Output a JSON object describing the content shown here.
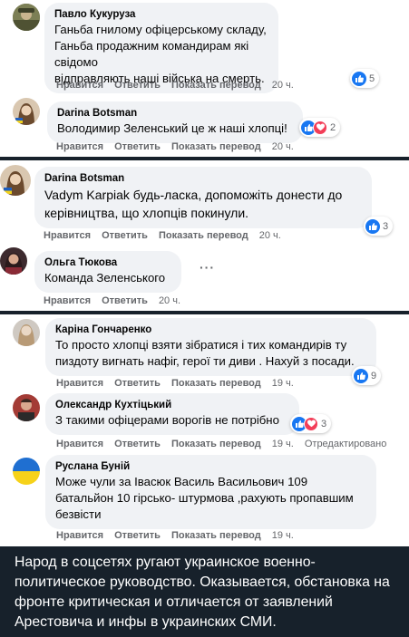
{
  "actions": {
    "like": "Нравится",
    "reply": "Ответить",
    "translate": "Показать перевод",
    "edited": "Отредактировано"
  },
  "comments": [
    {
      "author": "Павло Кукуруза",
      "text": "Ганьба гнилому офіцерському складу,\nГаньба продажним командирам які свідомо\nвідправляють наші війська на смерть.",
      "time": "20 ч.",
      "reactions": "5",
      "reaction_icons": [
        "like-icon"
      ]
    },
    {
      "author": "Darina Botsman",
      "text": "Володимир Зеленський це ж наші хлопці!",
      "time": "20 ч.",
      "reactions": "2",
      "reaction_icons": [
        "like-icon",
        "heart-icon"
      ]
    },
    {
      "author": "Darina Botsman",
      "text": "Vadym Karpiak будь-ласка, допоможіть донести до\nкерівництва, що хлопців покинули.",
      "time": "20 ч.",
      "reactions": "3",
      "reaction_icons": [
        "like-icon"
      ]
    },
    {
      "author": "Ольга Тюкова",
      "text": "Команда Зеленського",
      "time": "20 ч."
    },
    {
      "author": "Каріна Гончаренко",
      "text": "То просто хлопці взяти зібратися і тих командирів ту\nпиздоту вигнать нафіг, герої ти диви . Нахуй з посади.",
      "time": "19 ч.",
      "reactions": "9",
      "reaction_icons": [
        "like-icon"
      ]
    },
    {
      "author": "Олександр Кухтіцький",
      "text": "З такими офіцерами ворогів не потрібно",
      "time": "19 ч.",
      "reactions": "3",
      "reaction_icons": [
        "like-icon",
        "heart-icon"
      ]
    },
    {
      "author": "Руслана Буній",
      "text": "Може чули за Івасюк Василь Васильович 109\nбатальйон 10 гірсько- штурмова ,рахують пропавшим\nбезвісти",
      "time": "19 ч."
    }
  ],
  "caption": "Народ в соцсетях ругают украинское военно-политическое руководство. Оказывается, обстановка на фронте критическая и отличается от заявлений Арестовича и инфы в украинских СМИ.",
  "colors": {
    "background": "#17212b",
    "bubble": "#f0f2f5",
    "like": "#1877f2",
    "heart": "#f33e58",
    "meta_text": "#65676b"
  }
}
